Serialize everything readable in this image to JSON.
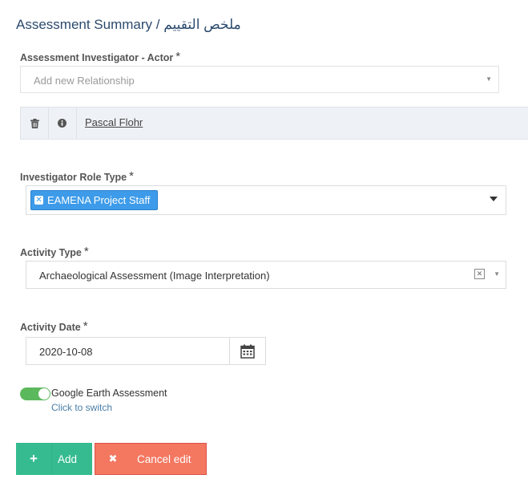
{
  "page_title": "Assessment Summary / ملخص التقييم",
  "required_marker": "*",
  "investigator": {
    "label": "Assessment Investigator - Actor",
    "placeholder": "Add new Relationship",
    "related_name": "Pascal Flohr"
  },
  "role_type": {
    "label": "Investigator Role Type",
    "selected_tag": "EAMENA Project Staff"
  },
  "activity_type": {
    "label": "Activity Type",
    "value": "Archaeological Assessment (Image Interpretation)"
  },
  "activity_date": {
    "label": "Activity Date",
    "value": "2020-10-08"
  },
  "google_earth": {
    "label": "Google Earth Assessment",
    "hint": "Click to switch",
    "enabled": true
  },
  "buttons": {
    "add": "Add",
    "cancel": "Cancel edit"
  },
  "colors": {
    "accent_green": "#35bb8f",
    "cancel_red": "#f47760",
    "tag_blue": "#3d9be9",
    "toggle_on": "#5cb85c"
  }
}
